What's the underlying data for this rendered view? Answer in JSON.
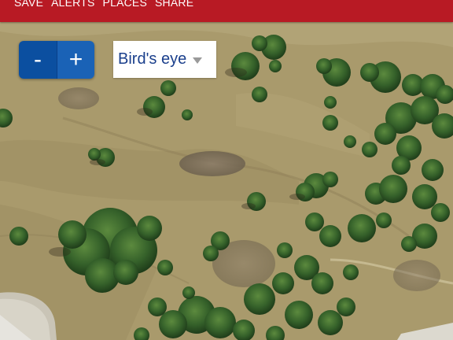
{
  "nav": {
    "items": [
      {
        "label": "SAVE"
      },
      {
        "label": "ALERTS"
      },
      {
        "label": "PLACES"
      },
      {
        "label": "SHARE"
      }
    ]
  },
  "zoom": {
    "out_label": "-",
    "in_label": "+"
  },
  "map_view": {
    "selected": "Bird's eye"
  },
  "colors": {
    "header_bg": "#b81a24",
    "zoom_out_bg": "#0b4fa0",
    "zoom_in_bg": "#1a62b6",
    "select_text": "#1a3f8c",
    "terrain": "#a89868",
    "tree": "#2f5a24"
  },
  "icons": {
    "view_dropdown": "chevron-down-icon"
  }
}
